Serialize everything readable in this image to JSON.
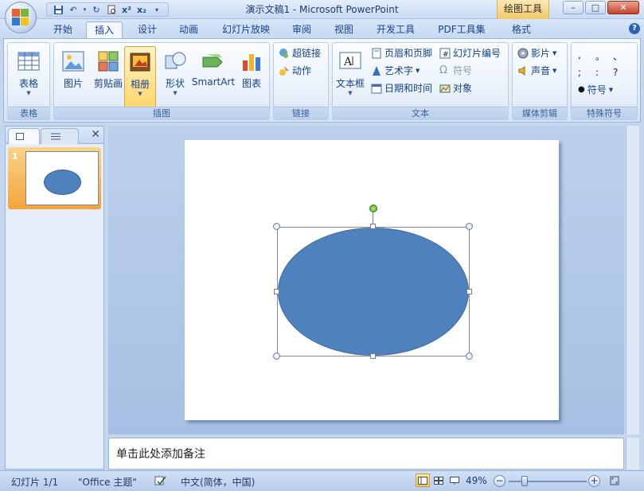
{
  "window": {
    "title": "演示文稿1 - Microsoft PowerPoint",
    "context_tab_title": "绘图工具",
    "controls": [
      "–",
      "□",
      "✕"
    ]
  },
  "qat": {
    "save_icon": "save-icon",
    "undo_icon": "undo-icon",
    "redo_icon": "redo-icon"
  },
  "tabs": [
    {
      "label": "开始"
    },
    {
      "label": "插入",
      "active": true
    },
    {
      "label": "设计"
    },
    {
      "label": "动画"
    },
    {
      "label": "幻灯片放映"
    },
    {
      "label": "审阅"
    },
    {
      "label": "视图"
    },
    {
      "label": "开发工具"
    },
    {
      "label": "PDF工具集"
    },
    {
      "label": "格式"
    }
  ],
  "ribbon": {
    "groups": {
      "table": {
        "label": "表格",
        "buttons": [
          {
            "label": "表格"
          }
        ]
      },
      "illustrations": {
        "label": "插图",
        "buttons": [
          {
            "label": "图片"
          },
          {
            "label": "剪贴画"
          },
          {
            "label": "相册"
          },
          {
            "label": "形状"
          },
          {
            "label": "SmartArt"
          },
          {
            "label": "图表"
          }
        ]
      },
      "links": {
        "label": "链接",
        "buttons": [
          {
            "label": "超链接"
          },
          {
            "label": "动作"
          }
        ]
      },
      "text": {
        "label": "文本",
        "big": {
          "label": "文本框"
        },
        "buttons": [
          {
            "label": "页眉和页脚"
          },
          {
            "label": "艺术字"
          },
          {
            "label": "日期和时间"
          },
          {
            "label": "幻灯片编号"
          },
          {
            "label": "符号"
          },
          {
            "label": "对象"
          }
        ]
      },
      "media": {
        "label": "媒体剪辑",
        "buttons": [
          {
            "label": "影片"
          },
          {
            "label": "声音"
          }
        ]
      },
      "special": {
        "label": "特殊符号",
        "symbols": [
          ",",
          "。",
          "、",
          ";",
          ":",
          "?"
        ],
        "button": {
          "label": "符号"
        }
      }
    }
  },
  "left_panel": {
    "slide_number": "1"
  },
  "notes": {
    "placeholder": "单击此处添加备注"
  },
  "status": {
    "slide": "幻灯片 1/1",
    "theme": "\"Office 主题\"",
    "language": "中文(简体，中国)",
    "zoom": "49%"
  },
  "colors": {
    "shape_fill": "#4f81bd",
    "shape_outline": "#3d6aa0"
  }
}
